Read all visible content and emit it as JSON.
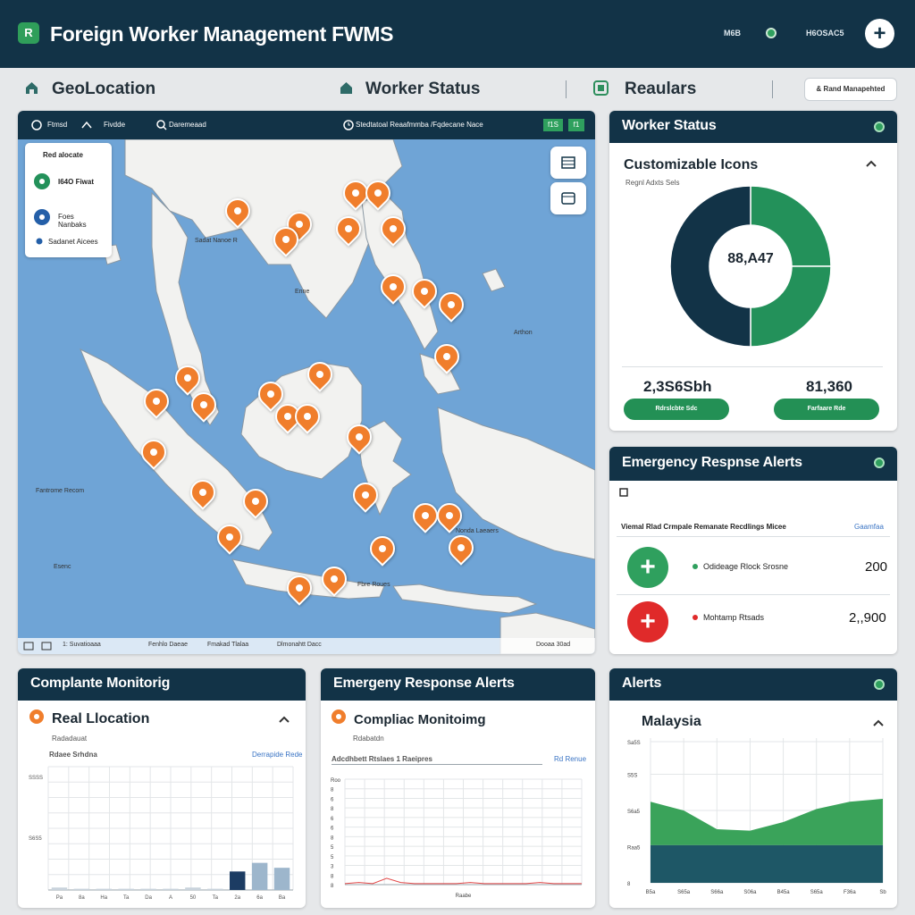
{
  "header": {
    "logo": "R",
    "title": "Foreign Worker Management FWMS",
    "small_1": "M6B",
    "small_2": "H6OSAC5",
    "plus_icon": "+"
  },
  "nav": {
    "items": [
      "GeoLocation",
      "Worker Status",
      "Reaulars"
    ],
    "button": "& Rand Manapehted"
  },
  "map": {
    "toolbar": [
      "Ftmsd",
      "Fivdde",
      "Daremeaad",
      "Stedtatoal Reaafmmba /Fqdecane Nace"
    ],
    "toolbar_buttons": [
      "f1S",
      "f1"
    ],
    "legend_title": "Red alocate",
    "legend_items": [
      "I64O Fiwat",
      "Foes Nanbaks"
    ],
    "legend_footer": "Sadanet Aicees",
    "labels": [
      "Sadat Nanoe R",
      "Enne",
      "Arthon",
      "Fantrome Recom",
      "Nonda Laeaers",
      "Esenc",
      "Fbre Roues"
    ],
    "footer": [
      "1: Suvatioaaa",
      "Fenhlo Daeae",
      "Fmakad Tlalaa",
      "Dlmonahtt Dacc",
      "Dooaa 30ad"
    ],
    "accent": "#f07e2c"
  },
  "worker_status": {
    "title": "Worker Status",
    "subtitle": "Customizable Icons",
    "caption": "Regnl Adxts Sels",
    "center": "88,A47",
    "stats": [
      "2,3S6Sbh",
      "81,360"
    ],
    "pills": [
      "Rdrslcbte  Sdc",
      "Farfaare  Rde"
    ],
    "colors": {
      "green": "#23915a",
      "navy": "#123347"
    }
  },
  "emergency_alerts": {
    "title": "Emergency Respnse Alerts",
    "subheading": "Viemal Rlad Crmpale Remanate Recdlings Micee",
    "link": "Gaamfaa",
    "items": [
      {
        "label": "Odideage Rlock Srosne",
        "value": "200",
        "color": "#2fa05e"
      },
      {
        "label": "Mohtamp Rtsads",
        "value": "2,,900",
        "color": "#e02a2a"
      }
    ]
  },
  "compliance": {
    "title": "Complante Monitorig",
    "subtitle": "Real Llocation",
    "caption": "Radadauat",
    "chart_title": "Rdaee Srhdna",
    "link": "Derrapide Rede",
    "ticks": [
      "SSSS",
      "S6S5"
    ],
    "x_labels": [
      "Pa",
      "8a",
      "Ha",
      "Ta",
      "Da",
      "A",
      "50",
      "Ta",
      "2a",
      "6a",
      "Ba"
    ]
  },
  "emergency_chart": {
    "title": "Emergeny Response Alerts",
    "subtitle": "Compliac Monitoimg",
    "caption": "Rdabatdn",
    "chart_title": "Adcdhbett Rtslaes 1 Raeipres",
    "link": "Rd Renue",
    "ticks": [
      "Roo",
      "8",
      "6",
      "8",
      "6",
      "6",
      "8",
      "5",
      "5",
      "3",
      "8",
      "8"
    ],
    "x_label": "Raabe"
  },
  "alerts": {
    "title": "Alerts",
    "subtitle": "Malaysia",
    "ticks": [
      "Sa5S",
      "S5S",
      "S6a5",
      "Raa5",
      "8"
    ],
    "x_labels": [
      "B5a",
      "S65a",
      "S66a",
      "S06a",
      "B45a",
      "S65a",
      "F36a",
      "Sb"
    ]
  },
  "chart_data": [
    {
      "type": "pie",
      "title": "",
      "categories": [
        "",
        "",
        ""
      ],
      "values": [
        25,
        25,
        50
      ],
      "colors": [
        "#23915a",
        "#23915a",
        "#123347"
      ]
    },
    {
      "type": "bar",
      "title": "Rdaee Srhdna",
      "categories": [
        "Pa",
        "8a",
        "Ha",
        "Ta",
        "Da",
        "A",
        "50",
        "Ta",
        "2a",
        "6a",
        "Ba"
      ],
      "values": [
        2,
        1,
        1,
        1,
        1,
        1,
        2,
        1,
        15,
        22,
        18
      ],
      "ylim": [
        0,
        100
      ]
    },
    {
      "type": "line",
      "title": "Adcdhbett Rtslaes 1 Raeipres",
      "xlabel": "Raabe",
      "values": [
        1,
        2,
        1,
        6,
        2,
        1,
        1,
        1,
        1,
        2,
        1,
        1,
        1,
        1,
        2,
        1,
        1,
        1
      ],
      "ylim": [
        0,
        100
      ]
    },
    {
      "type": "area",
      "title": "Malaysia",
      "x": [
        "B5a",
        "S65a",
        "S66a",
        "S06a",
        "B45a",
        "S65a",
        "F36a",
        "Sb"
      ],
      "series": [
        {
          "values": [
            26,
            26,
            26,
            26,
            26,
            26,
            26,
            26
          ]
        },
        {
          "values": [
            30,
            24,
            11,
            10,
            16,
            25,
            30,
            32
          ]
        }
      ],
      "ylim": [
        0,
        100
      ]
    }
  ]
}
